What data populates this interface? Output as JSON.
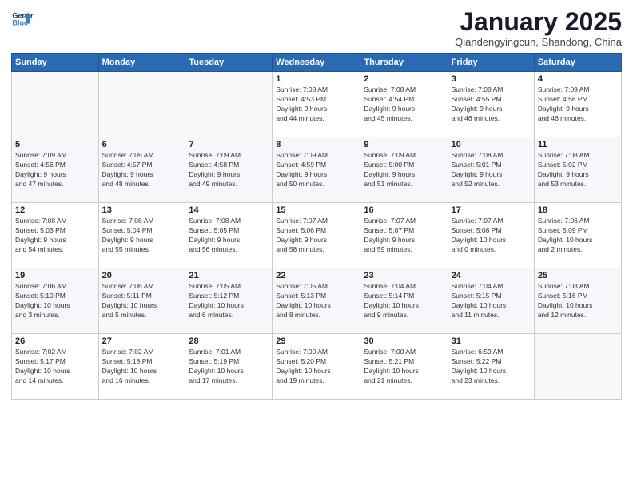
{
  "header": {
    "logo_line1": "General",
    "logo_line2": "Blue",
    "month_title": "January 2025",
    "subtitle": "Qiandengyingcun, Shandong, China"
  },
  "weekdays": [
    "Sunday",
    "Monday",
    "Tuesday",
    "Wednesday",
    "Thursday",
    "Friday",
    "Saturday"
  ],
  "weeks": [
    [
      {
        "day": "",
        "info": ""
      },
      {
        "day": "",
        "info": ""
      },
      {
        "day": "",
        "info": ""
      },
      {
        "day": "1",
        "info": "Sunrise: 7:08 AM\nSunset: 4:53 PM\nDaylight: 9 hours\nand 44 minutes."
      },
      {
        "day": "2",
        "info": "Sunrise: 7:08 AM\nSunset: 4:54 PM\nDaylight: 9 hours\nand 45 minutes."
      },
      {
        "day": "3",
        "info": "Sunrise: 7:08 AM\nSunset: 4:55 PM\nDaylight: 9 hours\nand 46 minutes."
      },
      {
        "day": "4",
        "info": "Sunrise: 7:09 AM\nSunset: 4:56 PM\nDaylight: 9 hours\nand 46 minutes."
      }
    ],
    [
      {
        "day": "5",
        "info": "Sunrise: 7:09 AM\nSunset: 4:56 PM\nDaylight: 9 hours\nand 47 minutes."
      },
      {
        "day": "6",
        "info": "Sunrise: 7:09 AM\nSunset: 4:57 PM\nDaylight: 9 hours\nand 48 minutes."
      },
      {
        "day": "7",
        "info": "Sunrise: 7:09 AM\nSunset: 4:58 PM\nDaylight: 9 hours\nand 49 minutes."
      },
      {
        "day": "8",
        "info": "Sunrise: 7:09 AM\nSunset: 4:59 PM\nDaylight: 9 hours\nand 50 minutes."
      },
      {
        "day": "9",
        "info": "Sunrise: 7:09 AM\nSunset: 5:00 PM\nDaylight: 9 hours\nand 51 minutes."
      },
      {
        "day": "10",
        "info": "Sunrise: 7:08 AM\nSunset: 5:01 PM\nDaylight: 9 hours\nand 52 minutes."
      },
      {
        "day": "11",
        "info": "Sunrise: 7:08 AM\nSunset: 5:02 PM\nDaylight: 9 hours\nand 53 minutes."
      }
    ],
    [
      {
        "day": "12",
        "info": "Sunrise: 7:08 AM\nSunset: 5:03 PM\nDaylight: 9 hours\nand 54 minutes."
      },
      {
        "day": "13",
        "info": "Sunrise: 7:08 AM\nSunset: 5:04 PM\nDaylight: 9 hours\nand 55 minutes."
      },
      {
        "day": "14",
        "info": "Sunrise: 7:08 AM\nSunset: 5:05 PM\nDaylight: 9 hours\nand 56 minutes."
      },
      {
        "day": "15",
        "info": "Sunrise: 7:07 AM\nSunset: 5:06 PM\nDaylight: 9 hours\nand 58 minutes."
      },
      {
        "day": "16",
        "info": "Sunrise: 7:07 AM\nSunset: 5:07 PM\nDaylight: 9 hours\nand 59 minutes."
      },
      {
        "day": "17",
        "info": "Sunrise: 7:07 AM\nSunset: 5:08 PM\nDaylight: 10 hours\nand 0 minutes."
      },
      {
        "day": "18",
        "info": "Sunrise: 7:06 AM\nSunset: 5:09 PM\nDaylight: 10 hours\nand 2 minutes."
      }
    ],
    [
      {
        "day": "19",
        "info": "Sunrise: 7:06 AM\nSunset: 5:10 PM\nDaylight: 10 hours\nand 3 minutes."
      },
      {
        "day": "20",
        "info": "Sunrise: 7:06 AM\nSunset: 5:11 PM\nDaylight: 10 hours\nand 5 minutes."
      },
      {
        "day": "21",
        "info": "Sunrise: 7:05 AM\nSunset: 5:12 PM\nDaylight: 10 hours\nand 6 minutes."
      },
      {
        "day": "22",
        "info": "Sunrise: 7:05 AM\nSunset: 5:13 PM\nDaylight: 10 hours\nand 8 minutes."
      },
      {
        "day": "23",
        "info": "Sunrise: 7:04 AM\nSunset: 5:14 PM\nDaylight: 10 hours\nand 9 minutes."
      },
      {
        "day": "24",
        "info": "Sunrise: 7:04 AM\nSunset: 5:15 PM\nDaylight: 10 hours\nand 11 minutes."
      },
      {
        "day": "25",
        "info": "Sunrise: 7:03 AM\nSunset: 5:16 PM\nDaylight: 10 hours\nand 12 minutes."
      }
    ],
    [
      {
        "day": "26",
        "info": "Sunrise: 7:02 AM\nSunset: 5:17 PM\nDaylight: 10 hours\nand 14 minutes."
      },
      {
        "day": "27",
        "info": "Sunrise: 7:02 AM\nSunset: 5:18 PM\nDaylight: 10 hours\nand 16 minutes."
      },
      {
        "day": "28",
        "info": "Sunrise: 7:01 AM\nSunset: 5:19 PM\nDaylight: 10 hours\nand 17 minutes."
      },
      {
        "day": "29",
        "info": "Sunrise: 7:00 AM\nSunset: 5:20 PM\nDaylight: 10 hours\nand 19 minutes."
      },
      {
        "day": "30",
        "info": "Sunrise: 7:00 AM\nSunset: 5:21 PM\nDaylight: 10 hours\nand 21 minutes."
      },
      {
        "day": "31",
        "info": "Sunrise: 6:59 AM\nSunset: 5:22 PM\nDaylight: 10 hours\nand 23 minutes."
      },
      {
        "day": "",
        "info": ""
      }
    ]
  ]
}
